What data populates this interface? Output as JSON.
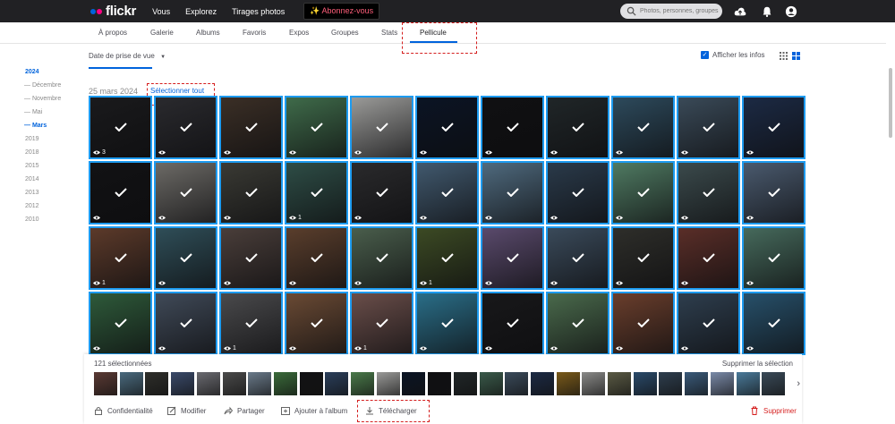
{
  "brand": {
    "name": "flickr"
  },
  "topnav": {
    "items": [
      "Vous",
      "Explorez",
      "Tirages photos"
    ],
    "subscribe": "Abonnez-vous",
    "subscribe_icon": "sparkle-icon"
  },
  "search": {
    "placeholder": "Photos, personnes, groupes"
  },
  "tabs": [
    "À propos",
    "Galerie",
    "Albums",
    "Favoris",
    "Expos",
    "Groupes",
    "Stats",
    "Pellicule"
  ],
  "active_tab": "Pellicule",
  "controls": {
    "sort_label": "Date de prise de vue",
    "show_info": "Afficher les infos",
    "show_info_checked": true
  },
  "years": [
    {
      "label": "2024",
      "active": true
    },
    {
      "label": "— Décembre",
      "active": false
    },
    {
      "label": "— Novembre",
      "active": false
    },
    {
      "label": "— Mai",
      "active": false
    },
    {
      "label": "— Mars",
      "active": true
    },
    {
      "label": "2019",
      "active": false
    },
    {
      "label": "2018",
      "active": false
    },
    {
      "label": "2015",
      "active": false
    },
    {
      "label": "2014",
      "active": false
    },
    {
      "label": "2013",
      "active": false
    },
    {
      "label": "2012",
      "active": false
    },
    {
      "label": "2010",
      "active": false
    }
  ],
  "section": {
    "date": "25 mars 2024",
    "select_all": "Sélectionner tout"
  },
  "photo_counts": [
    [
      "3",
      "",
      "",
      "",
      "",
      "",
      "",
      "",
      "",
      "",
      ""
    ],
    [
      "",
      "",
      "",
      "1",
      "",
      "",
      "",
      "",
      "",
      "",
      ""
    ],
    [
      "1",
      "",
      "",
      "",
      "",
      "1",
      "",
      "",
      "",
      "",
      ""
    ],
    [
      "",
      "",
      "1",
      "",
      "1",
      "",
      "",
      "",
      "",
      "",
      ""
    ]
  ],
  "selection": {
    "count_label": "121 sélectionnées",
    "remove_label": "Supprimer la sélection",
    "actions": {
      "privacy": "Confidentialité",
      "edit": "Modifier",
      "share": "Partager",
      "add_album": "Ajouter à l'album",
      "download": "Télécharger",
      "delete": "Supprimer"
    }
  },
  "colors": {
    "accent": "#0063dc",
    "selection_border": "#1d9bf0",
    "topbar": "#212124",
    "danger": "#d51e1e"
  }
}
